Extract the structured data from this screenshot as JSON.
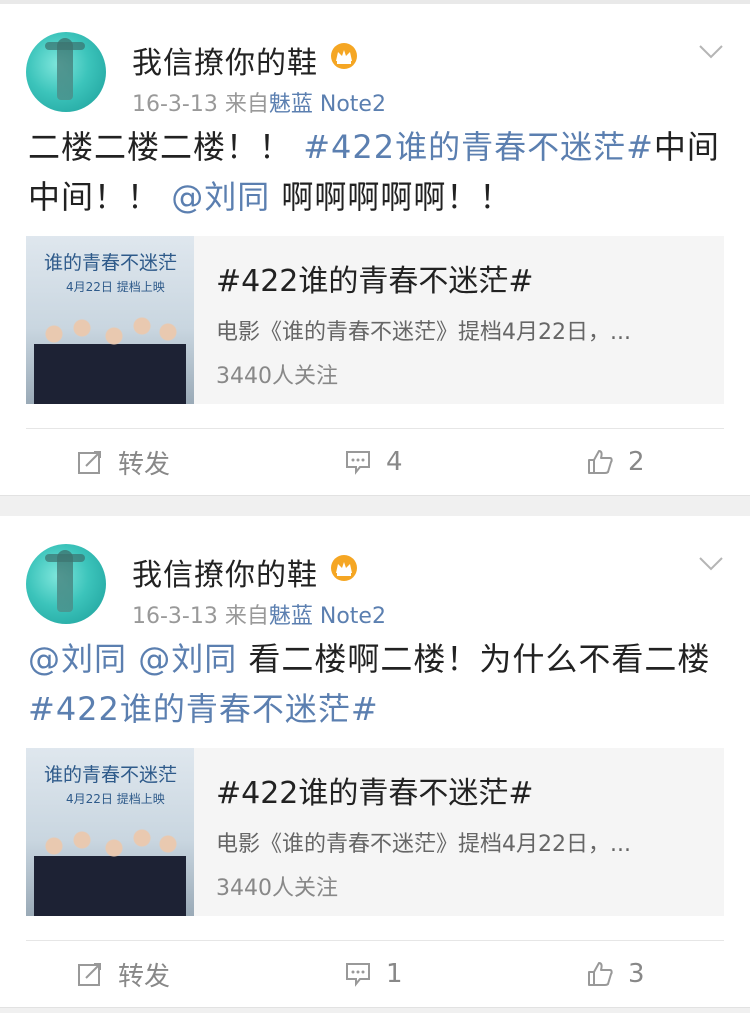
{
  "posts": [
    {
      "username": "我信撩你的鞋",
      "time": "16-3-13",
      "source_prefix": "来自",
      "device": "魅蓝 Note2",
      "text": {
        "p1": "二楼二楼二楼！！",
        "hashtag": "#422谁的青春不迷茫#",
        "p2": "中间中间！！",
        "mention": "@刘同",
        "p3": " 啊啊啊啊啊！！"
      },
      "card": {
        "title": "#422谁的青春不迷茫#",
        "desc": "电影《谁的青春不迷茫》提档4月22日，...",
        "count": "3440人关注",
        "thumb_title": "谁的青春不迷茫",
        "thumb_date": "4月22日 提档上映"
      },
      "actions": {
        "repost": "转发",
        "comments": "4",
        "likes": "2"
      }
    },
    {
      "username": "我信撩你的鞋",
      "time": "16-3-13",
      "source_prefix": "来自",
      "device": "魅蓝 Note2",
      "text": {
        "mention1": "@刘同",
        "mention2": "@刘同",
        "p1": " 看二楼啊二楼！为什么不看二楼",
        "hashtag": "#422谁的青春不迷茫#"
      },
      "card": {
        "title": "#422谁的青春不迷茫#",
        "desc": "电影《谁的青春不迷茫》提档4月22日，...",
        "count": "3440人关注",
        "thumb_title": "谁的青春不迷茫",
        "thumb_date": "4月22日 提档上映"
      },
      "actions": {
        "repost": "转发",
        "comments": "1",
        "likes": "3"
      }
    }
  ],
  "colors": {
    "link": "#5b7fb0",
    "meta": "#999999",
    "vip": "#f5a623"
  },
  "icons": [
    "vip-crown-icon",
    "chevron-down-icon",
    "repost-icon",
    "comment-icon",
    "like-icon"
  ]
}
